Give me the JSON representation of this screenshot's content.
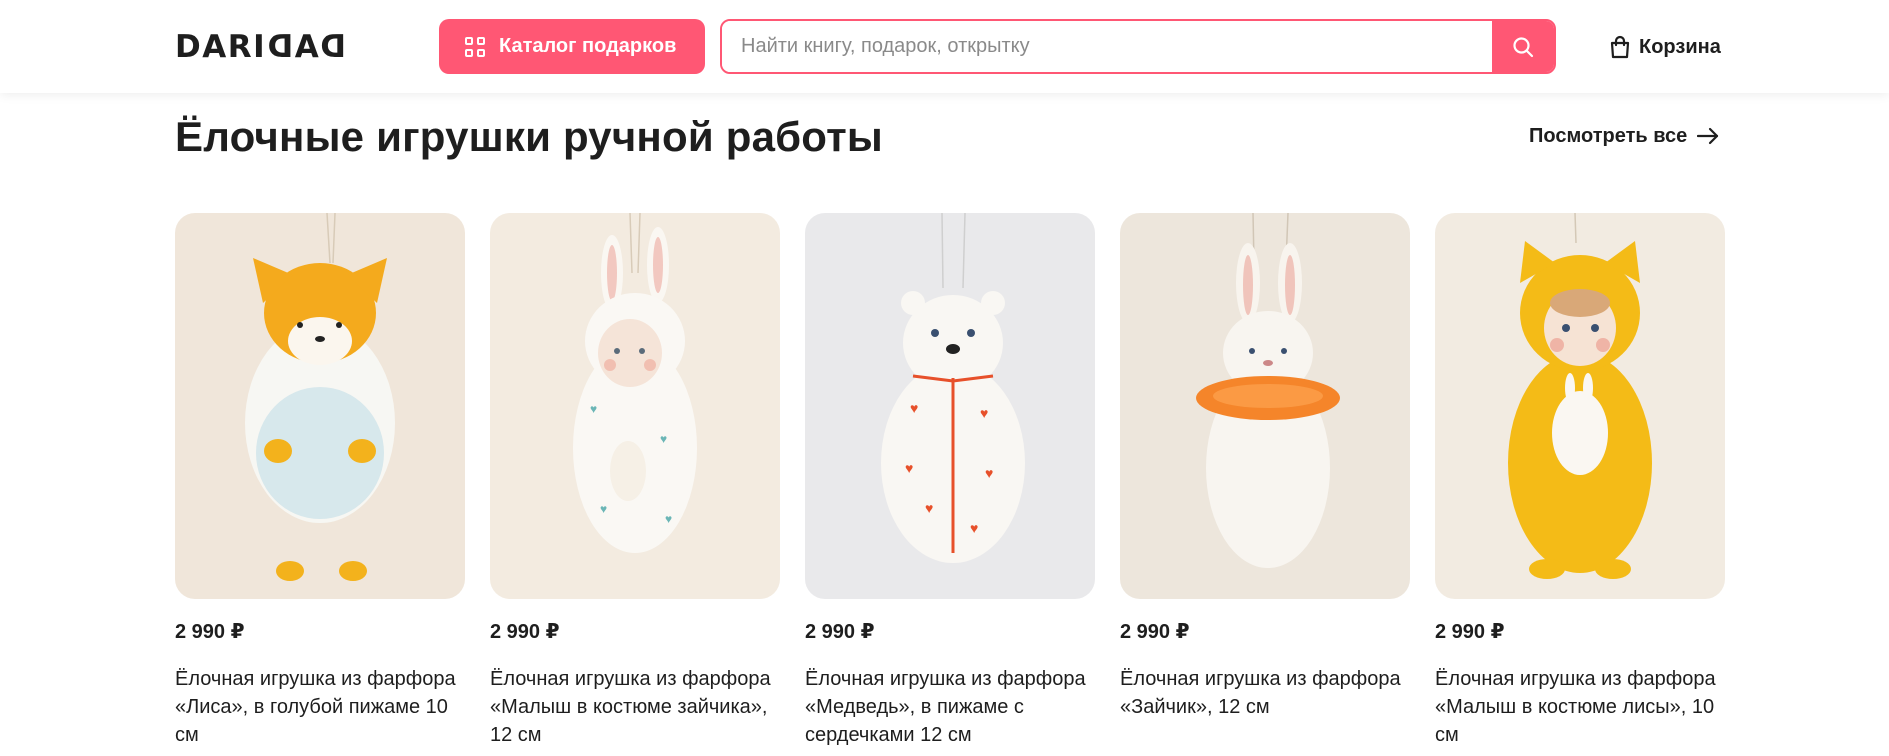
{
  "header": {
    "logo_text": "DARIDAD",
    "catalog_button_label": "Каталог подарков",
    "search_placeholder": "Найти книгу, подарок, открытку",
    "search_value": "",
    "cart_label": "Корзина",
    "accent_color": "#ff5774"
  },
  "section": {
    "title": "Ёлочные игрушки ручной работы",
    "see_all_label": "Посмотреть все"
  },
  "products": [
    {
      "price": "2 990 ₽",
      "title": "Ёлочная игрушка из фарфора «Лиса», в голубой пижаме 10 см",
      "image": "porcelain fox ornament in blue pajamas"
    },
    {
      "price": "2 990 ₽",
      "title": "Ёлочная игрушка из фарфора «Малыш в костюме зайчика», 12 см",
      "image": "porcelain baby in bunny costume ornament"
    },
    {
      "price": "2 990 ₽",
      "title": "Ёлочная игрушка из фарфора «Медведь», в пижаме с сердечками 12 см",
      "image": "porcelain bear in heart pajamas ornament"
    },
    {
      "price": "2 990 ₽",
      "title": "Ёлочная игрушка из фарфора «Зайчик», 12 см",
      "image": "porcelain bunny with orange scarf ornament"
    },
    {
      "price": "2 990 ₽",
      "title": "Ёлочная игрушка из фарфора «Малыш в костюме лисы», 10 см",
      "image": "porcelain baby in yellow fox costume ornament"
    }
  ]
}
